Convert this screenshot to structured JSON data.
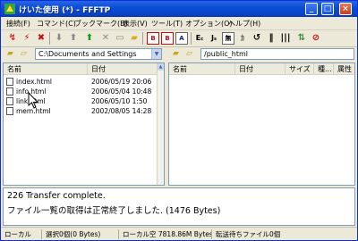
{
  "window": {
    "title": "けいた使用  (*) - FFFTP",
    "minimize_glyph": "_",
    "maximize_glyph": "□",
    "close_glyph": "×"
  },
  "menu": [
    "接続(F)",
    "コマンド(C)",
    "ブックマーク(B)",
    "表示(V)",
    "ツール(T)",
    "オプション(O)",
    "ヘルプ(H)"
  ],
  "toolbar": {
    "box_labels": {
      "B1": "B",
      "B2": "B",
      "A": "A",
      "E": "E",
      "J": "J",
      "kanji": "無"
    }
  },
  "local": {
    "path": "C:\\Documents and Settings",
    "columns": [
      "名前",
      "日付"
    ],
    "files": [
      {
        "name": "index.html",
        "date": "2006/05/19 20:06"
      },
      {
        "name": "info.html",
        "date": "2006/05/04 10:48"
      },
      {
        "name": "link.html",
        "date": "2006/05/10  1:50"
      },
      {
        "name": "mem.html",
        "date": "2002/08/05 14:28"
      }
    ]
  },
  "remote": {
    "path": "/public_html",
    "columns": [
      "名前",
      "日付",
      "サイズ",
      "種...",
      "属性"
    ],
    "files": []
  },
  "log": {
    "lines": [
      "226 Transfer complete.",
      "ファイル一覧の取得は正常終了しました. (1476 Bytes)"
    ]
  },
  "status": {
    "local": "ローカル",
    "selected": "選択0個(0 Bytes)",
    "free_space": "ローカル空 7818.86M Bytes",
    "queue": "転送待ちファイル0個"
  },
  "colors": {
    "accent": "#0a4fd7",
    "window_bg": "#ece9d8"
  }
}
